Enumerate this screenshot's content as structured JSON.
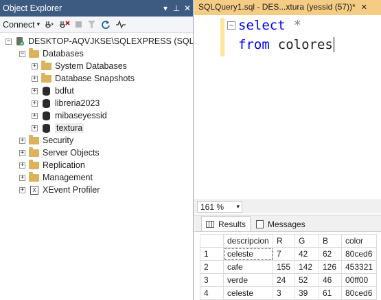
{
  "object_explorer": {
    "title": "Object Explorer",
    "title_buttons": [
      "▾",
      "⊥",
      "✕"
    ],
    "toolbar": {
      "connect_label": "Connect",
      "tools": [
        "connect-icon",
        "disconnect-icon",
        "stop-icon",
        "filter-icon",
        "refresh-icon",
        "activity-icon"
      ]
    },
    "tree": {
      "server": "DESKTOP-AQVJKSE\\SQLEXPRESS (SQL Server",
      "databases_label": "Databases",
      "databases": [
        {
          "label": "System Databases",
          "kind": "folder"
        },
        {
          "label": "Database Snapshots",
          "kind": "folder"
        },
        {
          "label": "bdfut",
          "kind": "db"
        },
        {
          "label": "libreria2023",
          "kind": "db"
        },
        {
          "label": "mibaseyessid",
          "kind": "db"
        },
        {
          "label": "textura",
          "kind": "db"
        }
      ],
      "top_folders": [
        {
          "label": "Security"
        },
        {
          "label": "Server Objects"
        },
        {
          "label": "Replication"
        },
        {
          "label": "Management"
        }
      ],
      "xevent": "XEvent Profiler"
    }
  },
  "editor": {
    "tab_title": "SQLQuery1.sql - DES...xtura (yessid (57))*",
    "tab_close": "✕",
    "line1": {
      "keyword": "select",
      "rest": "*"
    },
    "line2": {
      "keyword": "from",
      "rest": "colores"
    },
    "zoom": "161 %"
  },
  "results": {
    "tabs": [
      "Results",
      "Messages"
    ],
    "columns": [
      "descripcion",
      "R",
      "G",
      "B",
      "color"
    ],
    "rows": [
      {
        "n": "1",
        "descripcion": "celeste",
        "R": "7",
        "G": "42",
        "B": "62",
        "color": "80ced6"
      },
      {
        "n": "2",
        "descripcion": "cafe",
        "R": "155",
        "G": "142",
        "B": "126",
        "color": "453321"
      },
      {
        "n": "3",
        "descripcion": "verde",
        "R": "24",
        "G": "52",
        "B": "46",
        "color": "00ff00"
      },
      {
        "n": "4",
        "descripcion": "celeste",
        "R": "3",
        "G": "39",
        "B": "61",
        "color": "80ced6"
      }
    ]
  },
  "colors": {
    "title_bar": "#3d5a80",
    "tab_active": "#f5cc84",
    "keyword": "#0000ff",
    "folder": "#dcb35c"
  }
}
